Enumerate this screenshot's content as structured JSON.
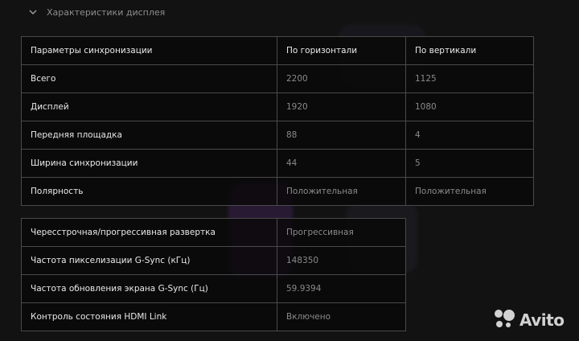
{
  "section": {
    "title": "Характеристики дисплея",
    "icon": "chevron-down-icon"
  },
  "timing_table": {
    "headers": [
      "Параметры синхронизации",
      "По горизонтали",
      "По вертикали"
    ],
    "rows": [
      [
        "Всего",
        "2200",
        "1125"
      ],
      [
        "Дисплей",
        "1920",
        "1080"
      ],
      [
        "Передняя площадка",
        "88",
        "4"
      ],
      [
        "Ширина синхронизации",
        "44",
        "5"
      ],
      [
        "Полярность",
        "Положительная",
        "Положительная"
      ]
    ]
  },
  "mode_table": {
    "rows": [
      [
        "Чересстрочная/прогрессивная развертка",
        "Прогрессивная"
      ],
      [
        "Частота пикселизации G-Sync (кГц)",
        "148350"
      ],
      [
        "Частота обновления экрана G-Sync (Гц)",
        "59.9394"
      ],
      [
        "Контроль состояния HDMI Link",
        "Включено"
      ]
    ]
  },
  "watermark": {
    "text": "Avito",
    "icon": "avito-logo-icon"
  },
  "colors": {
    "background": "#121212",
    "border": "#4a4a4a",
    "primary_text": "#eaeaea",
    "secondary_text": "#8a8a8a"
  }
}
